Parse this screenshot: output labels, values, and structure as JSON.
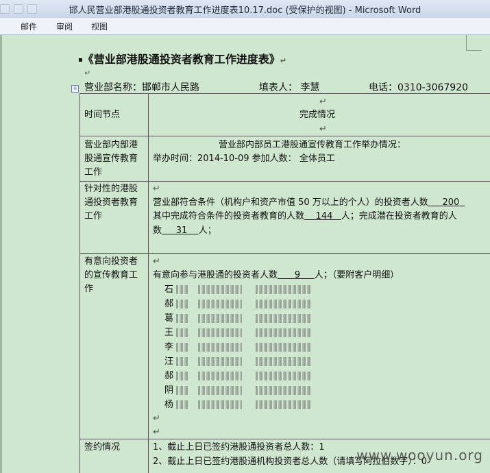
{
  "window": {
    "title": "邯人民营业部港股通投资者教育工作进度表10.17.doc (受保护的视图) - Microsoft Word"
  },
  "menu": {
    "items": [
      "邮件",
      "审阅",
      "视图"
    ]
  },
  "doc": {
    "heading": "《营业部港股通投资者教育工作进度表》",
    "info": {
      "dept": "营业部名称：邯郸市人民路",
      "filler": "填表人：  李慧",
      "phone": "电话：0310-3067920"
    },
    "table": {
      "header_left": "时间节点",
      "header_right": "完成情况",
      "row1_left_1": "营业部内部港",
      "row1_left_2": "股通宣传教育",
      "row1_left_3": "工作",
      "row1_right_line1": "营业部内部员工港股通宣传教育工作举办情况：",
      "row1_right_line2": "举办时间：2014-10-09    参加人数：  全体员工",
      "row2_left_1": "针对性的港股",
      "row2_left_2": "通投资者教育",
      "row2_left_3": "工作",
      "row2_right_line1": "营业部符合条件（机构户和资产市值 50 万以上的个人）的投资者人数",
      "row2_right_val1": "200",
      "row2_right_line2a": "其中完成符合条件的投资者教育的人数",
      "row2_right_val2": "144",
      "row2_right_line2b": "人；完成潜在投资者教育的人",
      "row2_right_line3a": "数",
      "row2_right_val3": "31",
      "row2_right_line3b": "人；",
      "row3_left_1": "有意向投资者",
      "row3_left_2": "的宣传教育工",
      "row3_left_3": "作",
      "row3_right_line1a": "有意向参与港股通的投资者人数",
      "row3_right_val1": "9",
      "row3_right_line1b": "人；（要附客户明细）",
      "clients": [
        "石",
        "郝",
        "葛",
        "王",
        "李",
        "汪",
        "郝",
        "阴",
        "杨"
      ],
      "row4_left": "签约情况",
      "row4_right_line1": "1、截止上日已签约港股通投资者总人数：1",
      "row4_right_line2": "2、截止上日已签约港股通机构投资者总人数（请填写阿拉伯数字）：0"
    }
  },
  "watermark": "www.wooyun.org"
}
